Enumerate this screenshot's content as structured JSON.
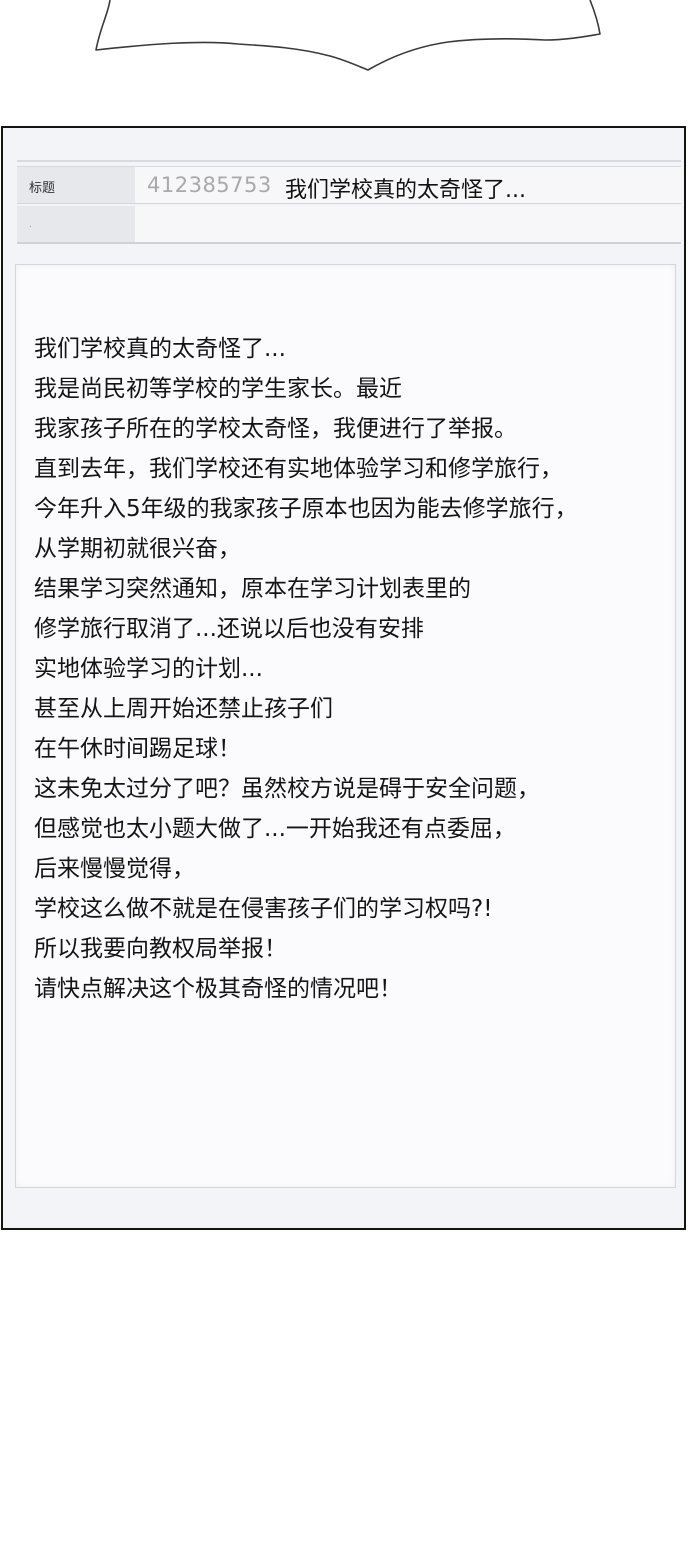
{
  "form": {
    "title_label": "标题",
    "post_id": "412385753",
    "subject": "我们学校真的太奇怪了...",
    "second_row_mark": "."
  },
  "body": {
    "lines": [
      "我们学校真的太奇怪了...",
      "我是尚民初等学校的学生家长。最近",
      "我家孩子所在的学校太奇怪，我便进行了举报。",
      "直到去年，我们学校还有实地体验学习和修学旅行，",
      "今年升入5年级的我家孩子原本也因为能去修学旅行，",
      "从学期初就很兴奋，",
      "结果学习突然通知，原本在学习计划表里的",
      "修学旅行取消了...还说以后也没有安排",
      "实地体验学习的计划...",
      "甚至从上周开始还禁止孩子们",
      "在午休时间踢足球！",
      "这未免太过分了吧？虽然校方说是碍于安全问题，",
      "但感觉也太小题大做了...一开始我还有点委屈，",
      "后来慢慢觉得，",
      "学校这么做不就是在侵害孩子们的学习权吗?!",
      "所以我要向教权局举报！",
      "请快点解决这个极其奇怪的情况吧！"
    ]
  }
}
